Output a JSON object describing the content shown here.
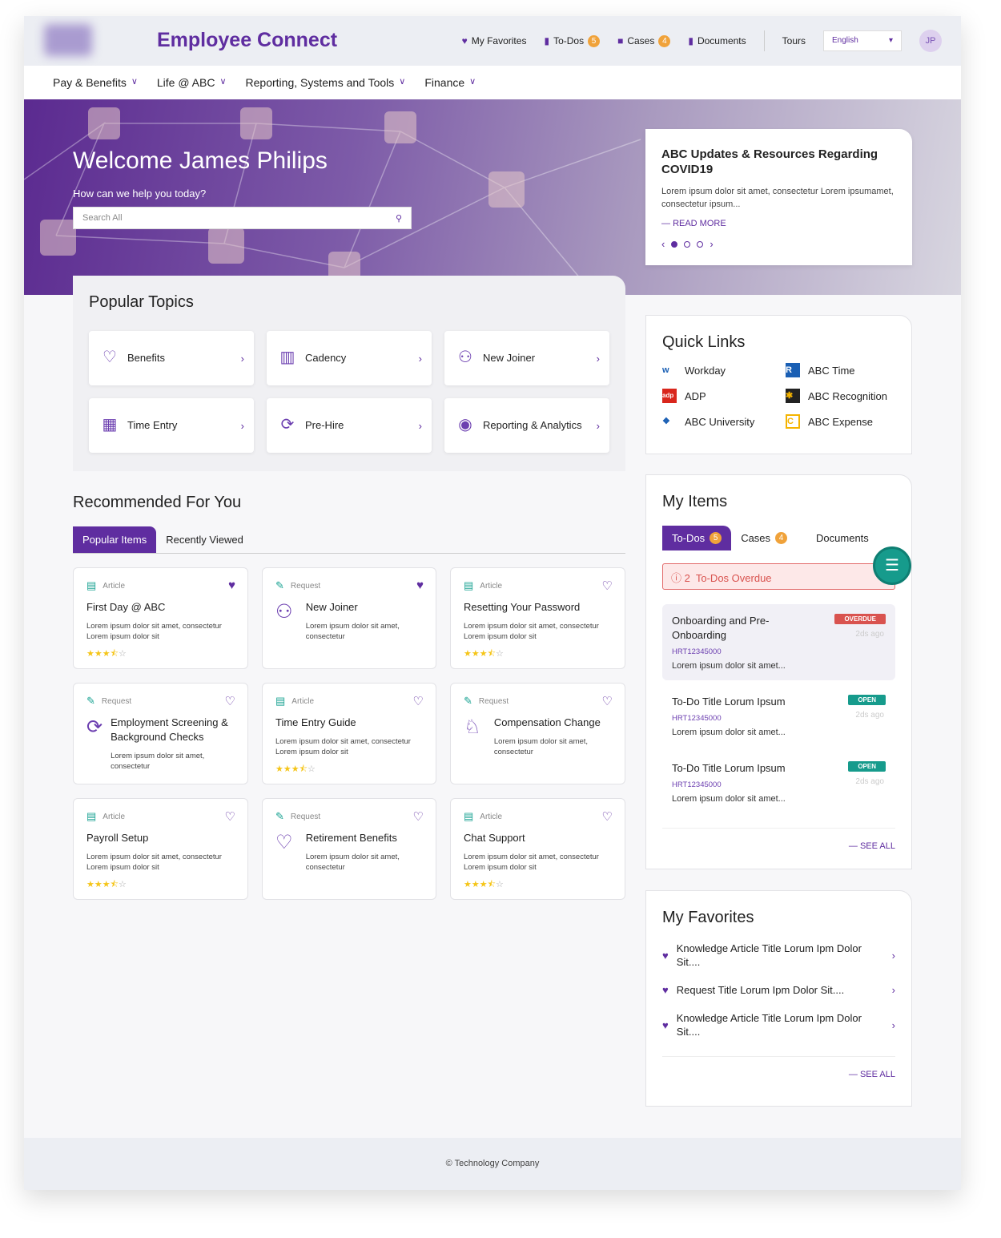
{
  "header": {
    "title": "Employee Connect",
    "links": [
      {
        "label": "My Favorites",
        "icon": "heart-icon"
      },
      {
        "label": "To-Dos",
        "badge": "5",
        "icon": "clipboard-icon"
      },
      {
        "label": "Cases",
        "badge": "4",
        "icon": "briefcase-icon"
      },
      {
        "label": "Documents",
        "icon": "document-icon"
      }
    ],
    "tours": "Tours",
    "language": "English",
    "avatar": "JP"
  },
  "nav": [
    "Pay & Benefits",
    "Life @ ABC",
    "Reporting, Systems and Tools",
    "Finance"
  ],
  "hero": {
    "welcome": "Welcome James Philips",
    "help": "How can we help you today?",
    "search_placeholder": "Search All"
  },
  "update": {
    "title": "ABC Updates & Resources Regarding COVID19",
    "body": "Lorem ipsum dolor sit amet, consectetur Lorem ipsumamet, consectetur  ipsum...",
    "read_more": "READ MORE"
  },
  "topics": {
    "title": "Popular Topics",
    "items": [
      "Benefits",
      "Cadency",
      "New Joiner",
      "Time Entry",
      "Pre-Hire",
      "Reporting & Analytics"
    ]
  },
  "recommended": {
    "title": "Recommended For You",
    "tabs": [
      "Popular Items",
      "Recently Viewed"
    ],
    "cards": [
      {
        "type": "Article",
        "title": "First Day @ ABC",
        "desc": "Lorem ipsum dolor sit amet, consectetur Lorem ipsum dolor sit",
        "rating": 3.5,
        "fav": true
      },
      {
        "type": "Request",
        "title": "New Joiner",
        "desc": "Lorem ipsum dolor sit amet, consectetur",
        "fav": true,
        "icon": "people-icon"
      },
      {
        "type": "Article",
        "title": "Resetting Your Password",
        "desc": "Lorem ipsum dolor sit amet, consectetur Lorem ipsum dolor sit",
        "rating": 3.5,
        "fav": false
      },
      {
        "type": "Request",
        "title": "Employment Screening & Background Checks",
        "desc": "Lorem ipsum dolor sit amet, consectetur",
        "fav": false,
        "icon": "screening-icon"
      },
      {
        "type": "Article",
        "title": "Time Entry Guide",
        "desc": "Lorem ipsum dolor sit amet, consectetur Lorem ipsum dolor sit",
        "rating": 3.5,
        "fav": false
      },
      {
        "type": "Request",
        "title": "Compensation Change",
        "desc": "Lorem ipsum dolor sit amet, consectetur",
        "fav": false,
        "icon": "piggy-bank-icon"
      },
      {
        "type": "Article",
        "title": "Payroll Setup",
        "desc": "Lorem ipsum dolor sit amet, consectetur Lorem ipsum dolor sit",
        "rating": 3.5,
        "fav": false
      },
      {
        "type": "Request",
        "title": "Retirement Benefits",
        "desc": "Lorem ipsum dolor sit amet, consectetur",
        "fav": false,
        "icon": "hand-heart-icon"
      },
      {
        "type": "Article",
        "title": "Chat Support",
        "desc": "Lorem ipsum dolor sit amet, consectetur Lorem ipsum dolor sit",
        "rating": 3.5,
        "fav": false
      }
    ]
  },
  "quick_links": {
    "title": "Quick Links",
    "items": [
      "Workday",
      "ABC Time",
      "ADP",
      "ABC Recognition",
      "ABC University",
      "ABC Expense"
    ]
  },
  "my_items": {
    "title": "My Items",
    "tabs": [
      {
        "label": "To-Dos",
        "badge": "5"
      },
      {
        "label": "Cases",
        "badge": "4"
      },
      {
        "label": "Documents"
      }
    ],
    "overdue_count": "2",
    "overdue_label": "To-Dos Overdue",
    "todos": [
      {
        "title": "Onboarding and Pre-Onboarding",
        "id": "HRT12345000",
        "desc": "Lorem ipsum dolor sit amet...",
        "status": "OVERDUE",
        "ago": "2ds ago"
      },
      {
        "title": "To-Do Title Lorum Ipsum",
        "id": "HRT12345000",
        "desc": "Lorem ipsum dolor sit amet...",
        "status": "OPEN",
        "ago": "2ds ago"
      },
      {
        "title": "To-Do Title Lorum Ipsum",
        "id": "HRT12345000",
        "desc": "Lorem ipsum dolor sit amet...",
        "status": "OPEN",
        "ago": "2ds ago"
      }
    ],
    "see_all": "SEE ALL"
  },
  "favorites": {
    "title": "My Favorites",
    "items": [
      "Knowledge Article Title Lorum Ipm Dolor Sit....",
      "Request Title Lorum Ipm Dolor Sit....",
      "Knowledge Article Title Lorum Ipm Dolor Sit...."
    ],
    "see_all": "SEE ALL"
  },
  "footer": "© Technology Company",
  "colors": {
    "brand": "#5f2da0",
    "badge": "#f0a23a",
    "overdue": "#d9534f",
    "open": "#169b8c"
  }
}
